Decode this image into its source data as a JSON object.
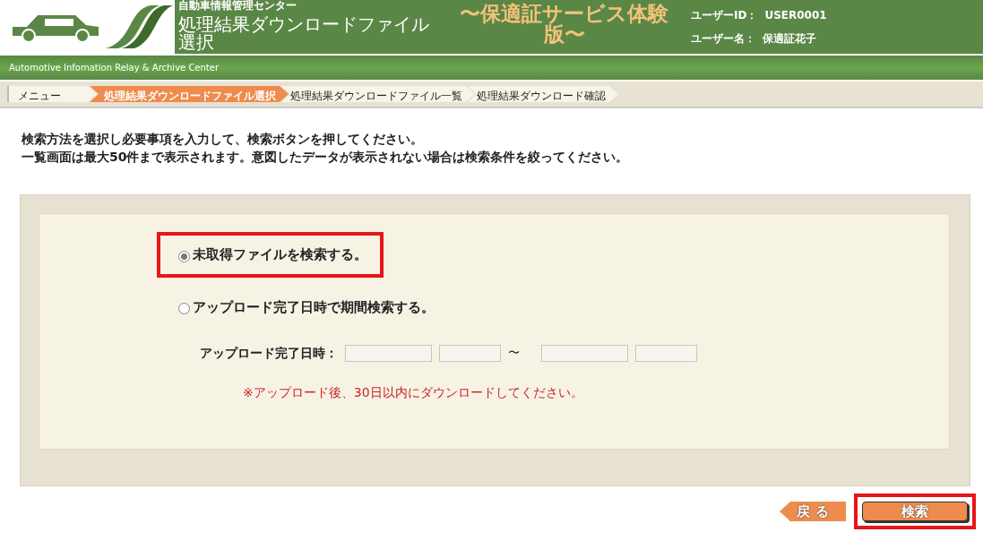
{
  "header": {
    "org": "自動車情報管理センター",
    "page_title": "処理結果ダウンロードファイル選択",
    "service_title": "〜保適証サービス体験版〜",
    "user_id_label": "ユーザーID：",
    "user_id": "USER0001",
    "user_name_label": "ユーザー名：",
    "user_name": "保適証花子"
  },
  "subheader": "Automotive Infomation Relay & Archive Center",
  "breadcrumb": [
    {
      "label": "メニュー",
      "kind": "first",
      "selected": false
    },
    {
      "label": "処理結果ダウンロードファイル選択",
      "kind": "step",
      "selected": true
    },
    {
      "label": "処理結果ダウンロードファイル一覧",
      "kind": "step",
      "selected": false
    },
    {
      "label": "処理結果ダウンロード確認",
      "kind": "step",
      "selected": false
    }
  ],
  "instructions": [
    "検索方法を選択し必要事項を入力して、検索ボタンを押してください。",
    "一覧画面は最大50件まで表示されます。意図したデータが表示されない場合は検索条件を絞ってください。"
  ],
  "options": [
    {
      "label": "未取得ファイルを検索する。",
      "selected": true,
      "highlighted": true
    },
    {
      "label": "アップロード完了日時で期間検索する。",
      "selected": false,
      "highlighted": false
    }
  ],
  "date_range": {
    "label": "アップロード完了日時：",
    "separator": "〜",
    "fields": [
      {
        "kind": "date"
      },
      {
        "kind": "time"
      },
      {
        "kind": "date"
      },
      {
        "kind": "time"
      }
    ]
  },
  "note": "※アップロード後、30日以内にダウンロードしてください。",
  "buttons": [
    {
      "label": "戻 る",
      "kind": "back",
      "highlighted": false
    },
    {
      "label": "検索",
      "kind": "search",
      "highlighted": true
    }
  ]
}
